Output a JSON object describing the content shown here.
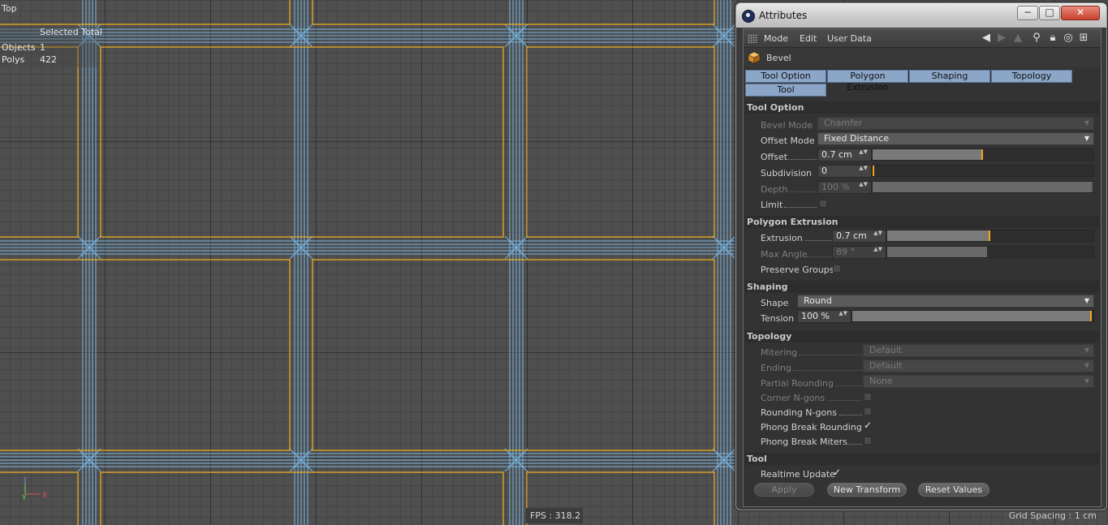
{
  "viewport": {
    "view_name": "Top",
    "stats_header": "Selected Total",
    "stats": [
      {
        "label": "Objects",
        "value": "1"
      },
      {
        "label": "Polys",
        "value": "422"
      }
    ],
    "axis_labels": {
      "y": "Y",
      "x": "X"
    },
    "fps": "FPS : 318.2",
    "grid_spacing": "Grid Spacing : 1 cm",
    "colors": {
      "edge": "#f5b21b",
      "bevel_lines": "#79b7e6",
      "grid": "#4f4f4f"
    }
  },
  "window": {
    "title": "Attributes",
    "controls": {
      "minimize": "−",
      "maximize": "□",
      "close": "✕"
    },
    "menu": [
      "Mode",
      "Edit",
      "User Data"
    ],
    "toolbar_icons": [
      "back-arrow-icon",
      "forward-arrow-icon",
      "up-arrow-icon",
      "search-icon",
      "lock-icon",
      "target-icon",
      "new-panel-icon"
    ],
    "object_name": "Bevel",
    "tabs": [
      "Tool Option",
      "Polygon Extrusion",
      "Shaping",
      "Topology",
      "Tool"
    ],
    "sections": {
      "tool_option": {
        "title": "Tool Option",
        "bevel_mode": {
          "label": "Bevel Mode",
          "value": "Chamfer"
        },
        "offset_mode": {
          "label": "Offset Mode",
          "value": "Fixed Distance"
        },
        "offset": {
          "label": "Offset",
          "value": "0.7 cm",
          "slider_fraction": 0.5
        },
        "subdivision": {
          "label": "Subdivision",
          "value": "0",
          "slider_fraction": 0.0
        },
        "depth": {
          "label": "Depth",
          "value": "100 %",
          "slider_fraction": 1.0
        },
        "limit": {
          "label": "Limit",
          "checked": false
        }
      },
      "polygon_extrusion": {
        "title": "Polygon Extrusion",
        "extrusion": {
          "label": "Extrusion",
          "value": "0.7 cm",
          "slider_fraction": 0.5
        },
        "max_angle": {
          "label": "Max Angle",
          "value": "89 °",
          "slider_fraction": 0.49
        },
        "preserve_groups": {
          "label": "Preserve Groups",
          "checked": false
        }
      },
      "shaping": {
        "title": "Shaping",
        "shape": {
          "label": "Shape",
          "value": "Round"
        },
        "tension": {
          "label": "Tension",
          "value": "100 %",
          "slider_fraction": 1.0
        }
      },
      "topology": {
        "title": "Topology",
        "mitering": {
          "label": "Mitering",
          "value": "Default"
        },
        "ending": {
          "label": "Ending",
          "value": "Default"
        },
        "partial_rounding": {
          "label": "Partial Rounding",
          "value": "None"
        },
        "corner_ngons": {
          "label": "Corner N-gons",
          "checked": false
        },
        "rounding_ngons": {
          "label": "Rounding N-gons",
          "checked": false
        },
        "phong_break_rounding": {
          "label": "Phong Break Rounding",
          "checked": true
        },
        "phong_break_miters": {
          "label": "Phong Break Miters",
          "checked": false
        }
      },
      "tool": {
        "title": "Tool",
        "realtime_update": {
          "label": "Realtime Update",
          "checked": true
        },
        "buttons": {
          "apply": "Apply",
          "new_transform": "New Transform",
          "reset_values": "Reset Values"
        }
      }
    },
    "checkmark_glyph": "✓",
    "dropdown_glyph": "▼",
    "spin_glyph": "▲▼"
  }
}
